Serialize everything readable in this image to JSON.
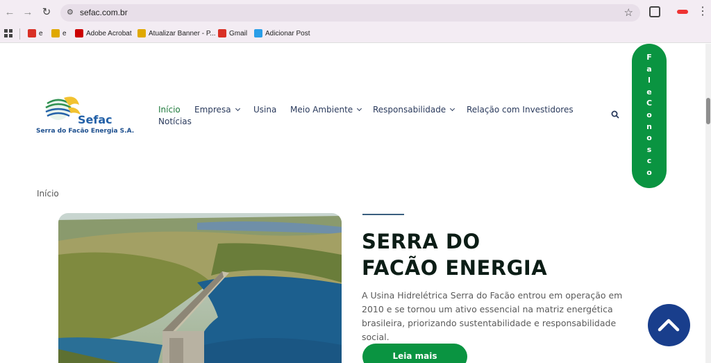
{
  "browser": {
    "url": "sefac.com.br",
    "bookmarks": [
      {
        "label": "e",
        "color": "#d93025"
      },
      {
        "label": "e",
        "color": "#e0a800"
      },
      {
        "label": "Adobe Acrobat",
        "color": "#c00"
      },
      {
        "label": "Atualizar Banner - P...",
        "color": "#e0a800"
      },
      {
        "label": "Gmail",
        "color": "#d93025"
      },
      {
        "label": "Adicionar Post",
        "color": "#2a9ee8"
      }
    ]
  },
  "site": {
    "logo_name": "Sefac",
    "logo_subtitle": "Serra do Facão Energia S.A.",
    "menu": [
      "Início",
      "Empresa",
      "Usina",
      "Meio Ambiente",
      "Responsabilidade",
      "Relação com Investidores",
      "Notícias"
    ],
    "contact_letters": [
      "F",
      "a",
      "l",
      "e",
      "C",
      "o",
      "n",
      "o",
      "s",
      "c",
      "o"
    ],
    "breadcrumb": "Início",
    "headline_line1": "SERRA DO",
    "headline_line2": "FACÃO ENERGIA",
    "description": "A Usina Hidrelétrica Serra do Facão entrou em operação em 2010 e se tornou um ativo essencial na matriz energética brasileira, priorizando sustentabilidade e responsabilidade social.",
    "cta_label": "Leia mais"
  },
  "colors": {
    "brand_green": "#0a9441",
    "brand_blue": "#193e8c",
    "menu_text": "#2a3a5c"
  }
}
